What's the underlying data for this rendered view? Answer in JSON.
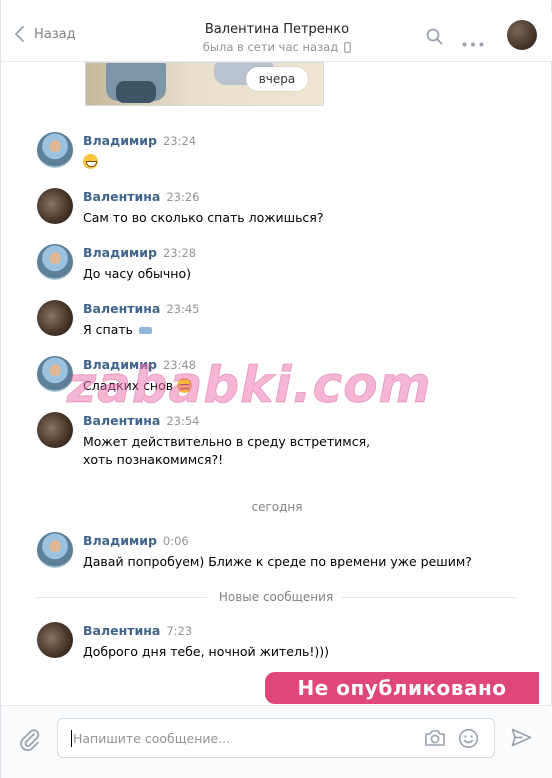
{
  "header": {
    "back_label": "Назад",
    "peer_name": "Валентина Петренко",
    "peer_status": "была в сети час назад"
  },
  "attachment": {
    "time_label": "вчера"
  },
  "messages": [
    {
      "author": "Владимир",
      "time": "23:24",
      "text": "",
      "emoji": "grinning-face"
    },
    {
      "author": "Валентина",
      "time": "23:26",
      "text": "Сам то во сколько спать ложишься?"
    },
    {
      "author": "Владимир",
      "time": "23:28",
      "text": "До часу обычно)"
    },
    {
      "author": "Валентина",
      "time": "23:45",
      "text": "Я спать",
      "emoji": "bed"
    },
    {
      "author": "Владимир",
      "time": "23:48",
      "text": "Сладких снов",
      "emoji": "sleeping-face"
    },
    {
      "author": "Валентина",
      "time": "23:54",
      "text": "Может действительно в среду встретимся, хоть познакомимся?!"
    },
    {
      "author": "Владимир",
      "time": "0:06",
      "text": "Давай попробуем) Ближе к среде по времени уже решим?"
    },
    {
      "author": "Валентина",
      "time": "7:23",
      "text": "Доброго дня тебе, ночной житель!)))"
    }
  ],
  "dividers": {
    "today": "сегодня",
    "new_messages": "Новые сообщения"
  },
  "watermark": {
    "site": "zababki.com",
    "badge": "Не опубликовано"
  },
  "composer": {
    "placeholder": "Напишите сообщение..."
  },
  "colors": {
    "author": "#42648b",
    "time": "#939393",
    "badge": "#e0457b"
  }
}
